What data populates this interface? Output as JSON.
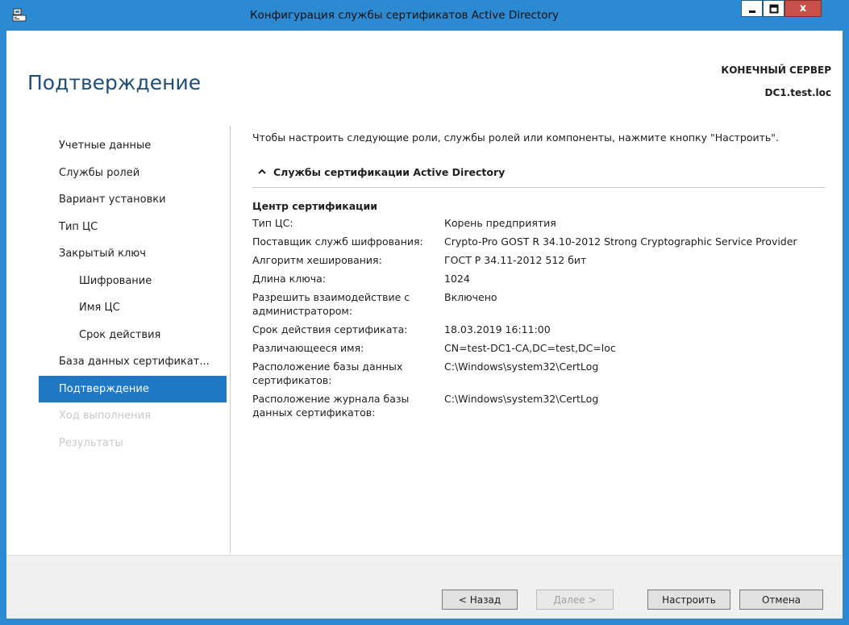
{
  "window": {
    "title": "Конфигурация службы сертификатов Active Directory",
    "controls": {
      "minimize": "minimize",
      "maximize": "maximize",
      "close": "x"
    }
  },
  "header": {
    "page_title": "Подтверждение",
    "server_label": "КОНЕЧНЫЙ СЕРВЕР",
    "server_name": "DC1.test.loc"
  },
  "nav": {
    "items": [
      {
        "label": "Учетные данные",
        "state": "normal"
      },
      {
        "label": "Службы ролей",
        "state": "normal"
      },
      {
        "label": "Вариант установки",
        "state": "normal"
      },
      {
        "label": "Тип ЦС",
        "state": "normal"
      },
      {
        "label": "Закрытый ключ",
        "state": "normal"
      },
      {
        "label": "Шифрование",
        "state": "sub"
      },
      {
        "label": "Имя ЦС",
        "state": "sub"
      },
      {
        "label": "Срок действия",
        "state": "sub"
      },
      {
        "label": "База данных сертификат...",
        "state": "normal"
      },
      {
        "label": "Подтверждение",
        "state": "active"
      },
      {
        "label": "Ход выполнения",
        "state": "disabled"
      },
      {
        "label": "Результаты",
        "state": "disabled"
      }
    ]
  },
  "content": {
    "intro": "Чтобы настроить следующие роли, службы ролей или компоненты, нажмите кнопку \"Настроить\".",
    "section_title": "Службы сертификации Active Directory",
    "group_title": "Центр сертификации",
    "details": [
      {
        "key": "Тип ЦС:",
        "value": "Корень предприятия"
      },
      {
        "key": "Поставщик служб шифрования:",
        "value": "Crypto-Pro GOST R 34.10-2012 Strong Cryptographic Service Provider"
      },
      {
        "key": "Алгоритм хеширования:",
        "value": "ГОСТ Р 34.11-2012 512 бит"
      },
      {
        "key": "Длина ключа:",
        "value": "1024"
      },
      {
        "key": "Разрешить взаимодействие с администратором:",
        "value": "Включено"
      },
      {
        "key": "Срок действия сертификата:",
        "value": "18.03.2019 16:11:00"
      },
      {
        "key": "Различающееся имя:",
        "value": "CN=test-DC1-CA,DC=test,DC=loc"
      },
      {
        "key": "Расположение базы данных сертификатов:",
        "value": "C:\\Windows\\system32\\CertLog"
      },
      {
        "key": "Расположение журнала базы данных сертификатов:",
        "value": "C:\\Windows\\system32\\CertLog"
      }
    ]
  },
  "footer": {
    "back_label": "< Назад",
    "next_label": "Далее >",
    "configure_label": "Настроить",
    "cancel_label": "Отмена"
  },
  "colors": {
    "title_bar": "#2b8ad1",
    "nav_active": "#1f78c4",
    "page_title": "#1e4e79",
    "close_button": "#c7504b"
  }
}
